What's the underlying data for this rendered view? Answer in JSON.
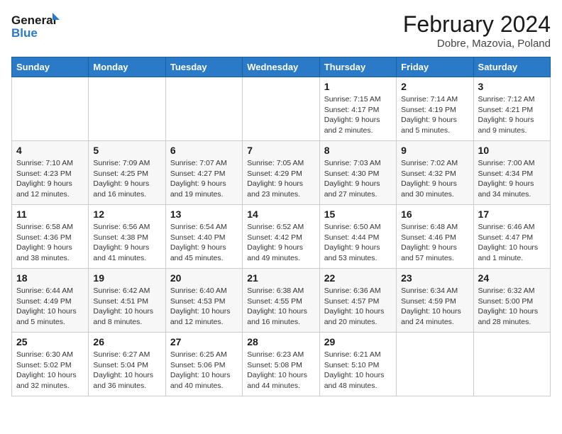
{
  "header": {
    "logo_line1": "General",
    "logo_line2": "Blue",
    "month_year": "February 2024",
    "location": "Dobre, Mazovia, Poland"
  },
  "weekdays": [
    "Sunday",
    "Monday",
    "Tuesday",
    "Wednesday",
    "Thursday",
    "Friday",
    "Saturday"
  ],
  "weeks": [
    [
      {
        "day": "",
        "info": ""
      },
      {
        "day": "",
        "info": ""
      },
      {
        "day": "",
        "info": ""
      },
      {
        "day": "",
        "info": ""
      },
      {
        "day": "1",
        "info": "Sunrise: 7:15 AM\nSunset: 4:17 PM\nDaylight: 9 hours\nand 2 minutes."
      },
      {
        "day": "2",
        "info": "Sunrise: 7:14 AM\nSunset: 4:19 PM\nDaylight: 9 hours\nand 5 minutes."
      },
      {
        "day": "3",
        "info": "Sunrise: 7:12 AM\nSunset: 4:21 PM\nDaylight: 9 hours\nand 9 minutes."
      }
    ],
    [
      {
        "day": "4",
        "info": "Sunrise: 7:10 AM\nSunset: 4:23 PM\nDaylight: 9 hours\nand 12 minutes."
      },
      {
        "day": "5",
        "info": "Sunrise: 7:09 AM\nSunset: 4:25 PM\nDaylight: 9 hours\nand 16 minutes."
      },
      {
        "day": "6",
        "info": "Sunrise: 7:07 AM\nSunset: 4:27 PM\nDaylight: 9 hours\nand 19 minutes."
      },
      {
        "day": "7",
        "info": "Sunrise: 7:05 AM\nSunset: 4:29 PM\nDaylight: 9 hours\nand 23 minutes."
      },
      {
        "day": "8",
        "info": "Sunrise: 7:03 AM\nSunset: 4:30 PM\nDaylight: 9 hours\nand 27 minutes."
      },
      {
        "day": "9",
        "info": "Sunrise: 7:02 AM\nSunset: 4:32 PM\nDaylight: 9 hours\nand 30 minutes."
      },
      {
        "day": "10",
        "info": "Sunrise: 7:00 AM\nSunset: 4:34 PM\nDaylight: 9 hours\nand 34 minutes."
      }
    ],
    [
      {
        "day": "11",
        "info": "Sunrise: 6:58 AM\nSunset: 4:36 PM\nDaylight: 9 hours\nand 38 minutes."
      },
      {
        "day": "12",
        "info": "Sunrise: 6:56 AM\nSunset: 4:38 PM\nDaylight: 9 hours\nand 41 minutes."
      },
      {
        "day": "13",
        "info": "Sunrise: 6:54 AM\nSunset: 4:40 PM\nDaylight: 9 hours\nand 45 minutes."
      },
      {
        "day": "14",
        "info": "Sunrise: 6:52 AM\nSunset: 4:42 PM\nDaylight: 9 hours\nand 49 minutes."
      },
      {
        "day": "15",
        "info": "Sunrise: 6:50 AM\nSunset: 4:44 PM\nDaylight: 9 hours\nand 53 minutes."
      },
      {
        "day": "16",
        "info": "Sunrise: 6:48 AM\nSunset: 4:46 PM\nDaylight: 9 hours\nand 57 minutes."
      },
      {
        "day": "17",
        "info": "Sunrise: 6:46 AM\nSunset: 4:47 PM\nDaylight: 10 hours\nand 1 minute."
      }
    ],
    [
      {
        "day": "18",
        "info": "Sunrise: 6:44 AM\nSunset: 4:49 PM\nDaylight: 10 hours\nand 5 minutes."
      },
      {
        "day": "19",
        "info": "Sunrise: 6:42 AM\nSunset: 4:51 PM\nDaylight: 10 hours\nand 8 minutes."
      },
      {
        "day": "20",
        "info": "Sunrise: 6:40 AM\nSunset: 4:53 PM\nDaylight: 10 hours\nand 12 minutes."
      },
      {
        "day": "21",
        "info": "Sunrise: 6:38 AM\nSunset: 4:55 PM\nDaylight: 10 hours\nand 16 minutes."
      },
      {
        "day": "22",
        "info": "Sunrise: 6:36 AM\nSunset: 4:57 PM\nDaylight: 10 hours\nand 20 minutes."
      },
      {
        "day": "23",
        "info": "Sunrise: 6:34 AM\nSunset: 4:59 PM\nDaylight: 10 hours\nand 24 minutes."
      },
      {
        "day": "24",
        "info": "Sunrise: 6:32 AM\nSunset: 5:00 PM\nDaylight: 10 hours\nand 28 minutes."
      }
    ],
    [
      {
        "day": "25",
        "info": "Sunrise: 6:30 AM\nSunset: 5:02 PM\nDaylight: 10 hours\nand 32 minutes."
      },
      {
        "day": "26",
        "info": "Sunrise: 6:27 AM\nSunset: 5:04 PM\nDaylight: 10 hours\nand 36 minutes."
      },
      {
        "day": "27",
        "info": "Sunrise: 6:25 AM\nSunset: 5:06 PM\nDaylight: 10 hours\nand 40 minutes."
      },
      {
        "day": "28",
        "info": "Sunrise: 6:23 AM\nSunset: 5:08 PM\nDaylight: 10 hours\nand 44 minutes."
      },
      {
        "day": "29",
        "info": "Sunrise: 6:21 AM\nSunset: 5:10 PM\nDaylight: 10 hours\nand 48 minutes."
      },
      {
        "day": "",
        "info": ""
      },
      {
        "day": "",
        "info": ""
      }
    ]
  ]
}
